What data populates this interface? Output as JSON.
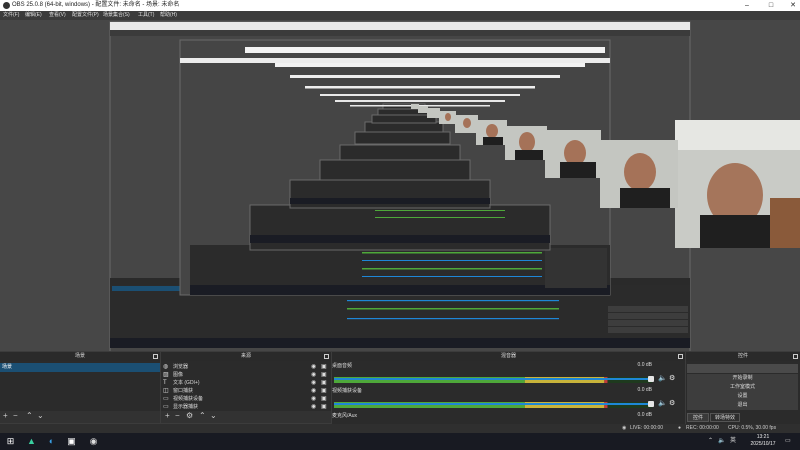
{
  "window": {
    "title": "OBS 25.0.8 (64-bit, windows) - 配置文件: 未命名 - 场景: 未命名"
  },
  "menu": [
    "文件(F)",
    "编辑(E)",
    "查看(V)",
    "配置文件(P)",
    "场景集合(S)",
    "工具(T)",
    "帮助(H)"
  ],
  "docks": {
    "scenes_title": "场景",
    "sources_title": "来源",
    "mixer_title": "混音器",
    "controls_title": "控件"
  },
  "scenes": [
    "场景"
  ],
  "sources": [
    {
      "icon": "browser-icon",
      "label": "浏览器"
    },
    {
      "icon": "image-icon",
      "label": "图像"
    },
    {
      "icon": "text-icon",
      "label": "文本 (GDI+)"
    },
    {
      "icon": "window-capture-icon",
      "label": "窗口捕获"
    },
    {
      "icon": "video-capture-icon",
      "label": "视频捕获设备"
    },
    {
      "icon": "display-capture-icon",
      "label": "显示器捕获"
    }
  ],
  "mixer": [
    {
      "name": "桌面音频",
      "db": "0.0 dB",
      "level": 0.86
    },
    {
      "name": "视频捕获设备",
      "db": "0.0 dB",
      "level": 0.86
    },
    {
      "name": "麦克风/Aux",
      "db": "0.0 dB",
      "level": 0.08
    }
  ],
  "controls": {
    "buttons": [
      "",
      "开始录制",
      "工作室模式",
      "设置",
      "退出"
    ],
    "tab_controls": "控件",
    "tab_transitions": "转场特效"
  },
  "status": {
    "live": "LIVE: 00:00:00",
    "rec": "REC: 00:00:00",
    "cpu": "CPU: 0.5%, 30.00 fps"
  },
  "taskbar": {
    "ime": "英",
    "time": "13:21",
    "date": "2025/10/17"
  },
  "colors": {
    "scene_selected": "#1b4f73",
    "slider": "#1e87d6",
    "meter_green": "#4ea83a",
    "meter_yellow": "#c8b43a",
    "meter_red": "#c03a3a"
  }
}
